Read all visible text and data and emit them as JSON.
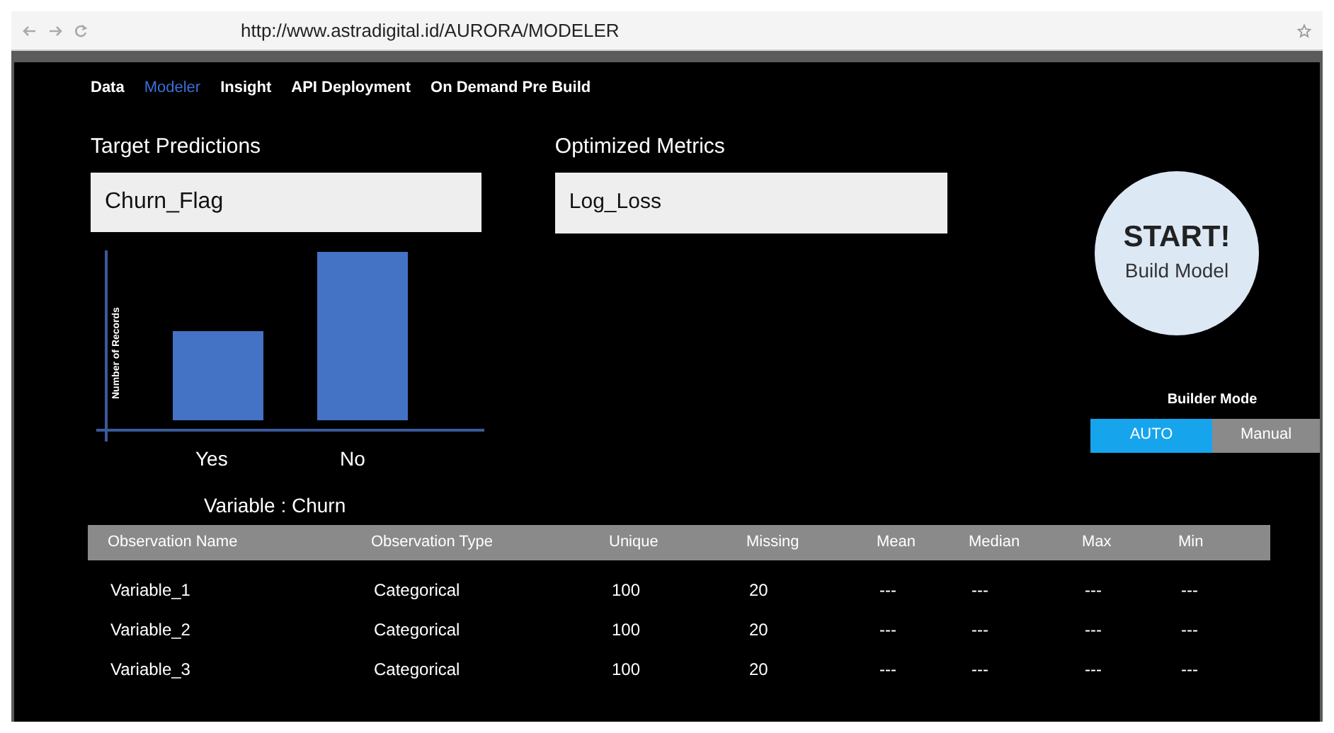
{
  "browser": {
    "url": "http://www.astradigital.id/AURORA/MODELER"
  },
  "nav_tabs": [
    {
      "label": "Data",
      "selected": false
    },
    {
      "label": "Modeler",
      "selected": true
    },
    {
      "label": "Insight",
      "selected": false
    },
    {
      "label": "API Deployment",
      "selected": false
    },
    {
      "label": "On Demand Pre Build",
      "selected": false
    }
  ],
  "target_predictions": {
    "label": "Target Predictions",
    "value": "Churn_Flag"
  },
  "optimized_metrics": {
    "label": "Optimized Metrics",
    "value": "Log_Loss"
  },
  "chart": {
    "y_label": "Number of Records",
    "categories": [
      "Yes",
      "No"
    ],
    "caption": "Variable : Churn"
  },
  "start_button": {
    "title": "START!",
    "subtitle": "Build Model"
  },
  "builder_mode": {
    "label": "Builder Mode",
    "options": [
      {
        "label": "AUTO",
        "selected": true
      },
      {
        "label": "Manual",
        "selected": false
      }
    ]
  },
  "table": {
    "columns": [
      "Observation Name",
      "Observation Type",
      "Unique",
      "Missing",
      "Mean",
      "Median",
      "Max",
      "Min"
    ],
    "rows": [
      [
        "Variable_1",
        "Categorical",
        "100",
        "20",
        "---",
        "---",
        "---",
        "---"
      ],
      [
        "Variable_2",
        "Categorical",
        "100",
        "20",
        "---",
        "---",
        "---",
        "---"
      ],
      [
        "Variable_3",
        "Categorical",
        "100",
        "20",
        "---",
        "---",
        "---",
        "---"
      ]
    ]
  }
}
